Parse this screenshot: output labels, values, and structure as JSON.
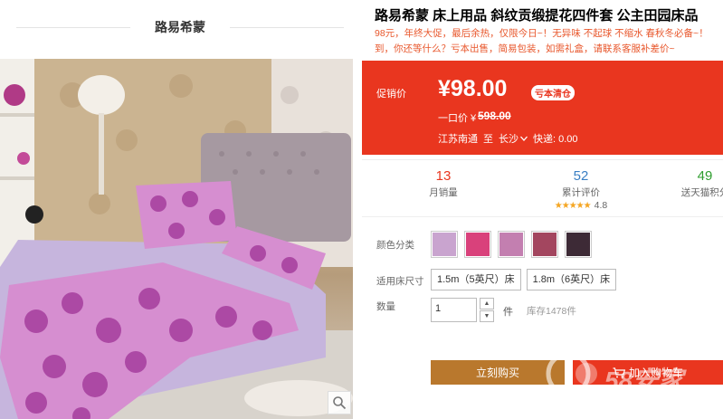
{
  "store": {
    "name": "路易希蒙"
  },
  "product": {
    "title": "路易希蒙 床上用品 斜纹贡缎提花四件套 公主田园床品",
    "desc_line1": "98元，年终大促，最后余热，仅限今日~！无异味 不起球 不缩水 春秋冬必备~！",
    "desc_line2": "到，你还等什么？亏本出售，简易包装，如需礼盒，请联系客服补差价~"
  },
  "price": {
    "label": "促销价",
    "value": "¥98.00",
    "badge": "亏本清仓",
    "orig_label": "一口价 ¥",
    "orig_value": "598.00",
    "ship_from": "江苏南通",
    "ship_to_label": "至",
    "ship_to": "长沙",
    "shipping": "快递: 0.00"
  },
  "stats": {
    "monthly_sales": "13",
    "monthly_sales_label": "月销量",
    "reviews": "52",
    "reviews_label": "累计评价",
    "rating": "4.8",
    "points": "49",
    "points_label": "送天猫积分"
  },
  "options": {
    "color_label": "颜色分类",
    "colors": [
      "#c9a4cf",
      "#d9417b",
      "#c37fb0",
      "#a3465f",
      "#3d2a36"
    ],
    "size_label": "适用床尺寸",
    "sizes": [
      "1.5m（5英尺）床",
      "1.8m（6英尺）床"
    ],
    "qty_label": "数量",
    "qty_value": "1",
    "unit": "件",
    "stock": "库存1478件"
  },
  "actions": {
    "buy_now": "立刻购买",
    "add_cart": "加入购物车"
  },
  "watermark": "58安家"
}
